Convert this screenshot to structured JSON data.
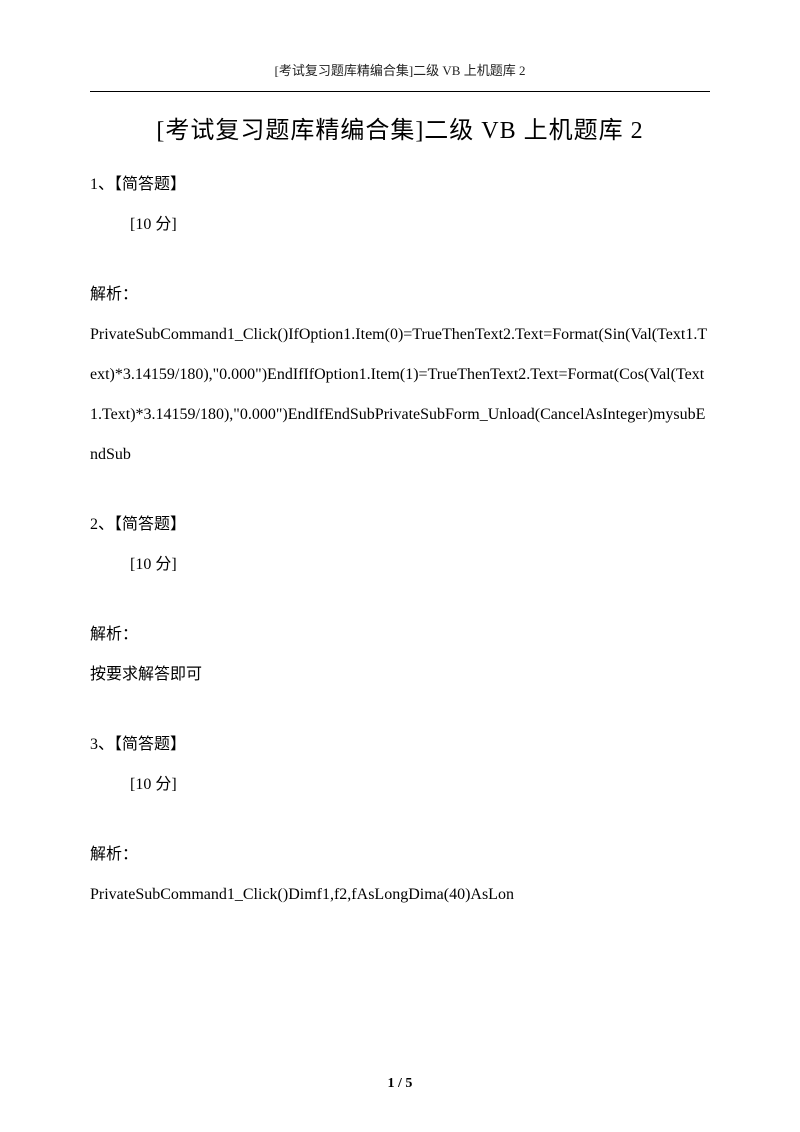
{
  "header": "[考试复习题库精编合集]二级 VB 上机题库 2",
  "title": "[考试复习题库精编合集]二级 VB 上机题库 2",
  "questions": [
    {
      "number": "1、【简答题】",
      "score": "[10 分]",
      "analysisLabel": "解析：",
      "analysisText": "PrivateSubCommand1_Click()IfOption1.Item(0)=TrueThenText2.Text=Format(Sin(Val(Text1.Text)*3.14159/180),\"0.000\")EndIfIfOption1.Item(1)=TrueThenText2.Text=Format(Cos(Val(Text1.Text)*3.14159/180),\"0.000\")EndIfEndSubPrivateSubForm_Unload(CancelAsInteger)mysubEndSub"
    },
    {
      "number": "2、【简答题】",
      "score": "[10 分]",
      "analysisLabel": "解析：",
      "analysisText": "按要求解答即可"
    },
    {
      "number": "3、【简答题】",
      "score": "[10 分]",
      "analysisLabel": "解析：",
      "analysisText": "PrivateSubCommand1_Click()Dimf1,f2,fAsLongDima(40)AsLon"
    }
  ],
  "footer": "1 / 5"
}
